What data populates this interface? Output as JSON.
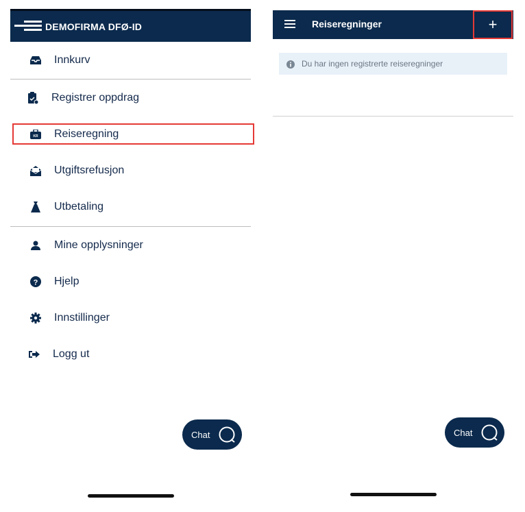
{
  "left": {
    "company": "DEMOFIRMA DFØ-ID",
    "menu": [
      {
        "label": "Innkurv",
        "icon": "inbox-icon"
      },
      {
        "label": "Registrer oppdrag",
        "icon": "clipboard-icon"
      },
      {
        "label": "Reiseregning",
        "icon": "briefcase-kr-icon",
        "highlighted": true
      },
      {
        "label": "Utgiftsrefusjon",
        "icon": "envelope-open-icon"
      },
      {
        "label": "Utbetaling",
        "icon": "money-bag-icon"
      },
      {
        "label": "Mine opplysninger",
        "icon": "person-icon"
      },
      {
        "label": "Hjelp",
        "icon": "question-circle-icon"
      },
      {
        "label": "Innstillinger",
        "icon": "gear-icon"
      },
      {
        "label": "Logg ut",
        "icon": "sign-out-icon"
      }
    ],
    "chat_label": "Chat"
  },
  "right": {
    "title": "Reiseregninger",
    "add_label": "+",
    "info_text": "Du har ingen registrerte reiseregninger",
    "chat_label": "Chat"
  },
  "colors": {
    "navy": "#0b2a4d",
    "highlight_red": "#e53935",
    "info_bg": "#e8f1f8"
  }
}
